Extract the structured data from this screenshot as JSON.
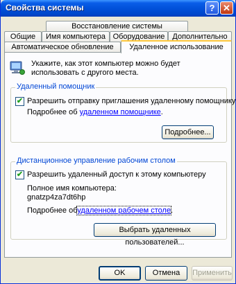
{
  "window": {
    "title": "Свойства системы"
  },
  "tabs": {
    "row1": [
      "Восстановление системы"
    ],
    "row2": [
      "Общие",
      "Имя компьютера",
      "Оборудование",
      "Дополнительно"
    ],
    "row3": [
      "Автоматическое обновление",
      "Удаленное использование"
    ]
  },
  "intro": "Укажите, как этот компьютер можно будет использовать с другого места.",
  "remote_assistance": {
    "group_title": "Удаленный помощник",
    "checkbox_label": "Разрешить отправку приглашения удаленному помощнику",
    "checked": true,
    "more_prefix": "Подробнее об",
    "more_link": "удаленном помощнике",
    "more_suffix": ".",
    "advanced_button": "Подробнее..."
  },
  "remote_desktop": {
    "group_title": "Дистанционное управление рабочим столом",
    "checkbox_label": "Разрешить удаленный доступ к этому компьютеру",
    "checked": true,
    "full_name_label": "Полное имя компьютера:",
    "computer_name": "gnatzp4za7dt6hp",
    "more_prefix": "Подробнее об",
    "more_link": "удаленном рабочем столе",
    "more_suffix": ".",
    "select_users_button": "Выбрать удаленных пользователей..."
  },
  "footer": {
    "ok": "OK",
    "cancel": "Отмена",
    "apply": "Применить"
  },
  "colors": {
    "titlebar": "#0151da",
    "group_title": "#0046d5",
    "link": "#0000ff",
    "active_tab_accent": "#ffc83c"
  }
}
